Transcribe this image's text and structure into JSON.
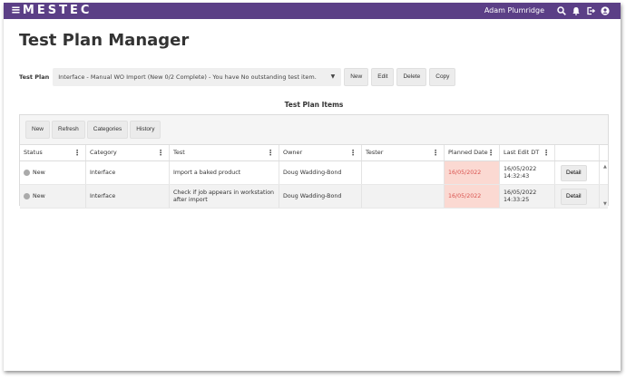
{
  "header": {
    "brand": "MESTEC",
    "user": "Adam Plumridge",
    "icons": [
      "search-icon",
      "bell-icon",
      "logout-icon",
      "user-icon"
    ]
  },
  "page": {
    "title": "Test Plan Manager"
  },
  "test_plan": {
    "label": "Test Plan",
    "selected": "Interface - Manual WO Import (New 0/2 Complete) - You have No outstanding test item.",
    "buttons": {
      "new": "New",
      "edit": "Edit",
      "delete": "Delete",
      "copy": "Copy"
    }
  },
  "items": {
    "title": "Test Plan Items",
    "toolbar": {
      "new": "New",
      "refresh": "Refresh",
      "categories": "Categories",
      "history": "History"
    },
    "columns": {
      "status": "Status",
      "category": "Category",
      "test": "Test",
      "owner": "Owner",
      "tester": "Tester",
      "planned": "Planned Date",
      "last": "Last Edit DT"
    },
    "rows": [
      {
        "status": "New",
        "category": "Interface",
        "test": "Import a baked product",
        "owner": "Doug Wadding-Bond",
        "tester": "",
        "planned": "16/05/2022",
        "last": "16/05/2022 14:32:43",
        "action": "Detail"
      },
      {
        "status": "New",
        "category": "Interface",
        "test": "Check if job appears in workstation after import",
        "owner": "Doug Wadding-Bond",
        "tester": "",
        "planned": "16/05/2022",
        "last": "16/05/2022 14:33:25",
        "action": "Detail"
      }
    ]
  },
  "colors": {
    "brand_bar": "#5b3f86",
    "overdue_bg": "#fbd9d2",
    "overdue_text": "#d9534f"
  }
}
